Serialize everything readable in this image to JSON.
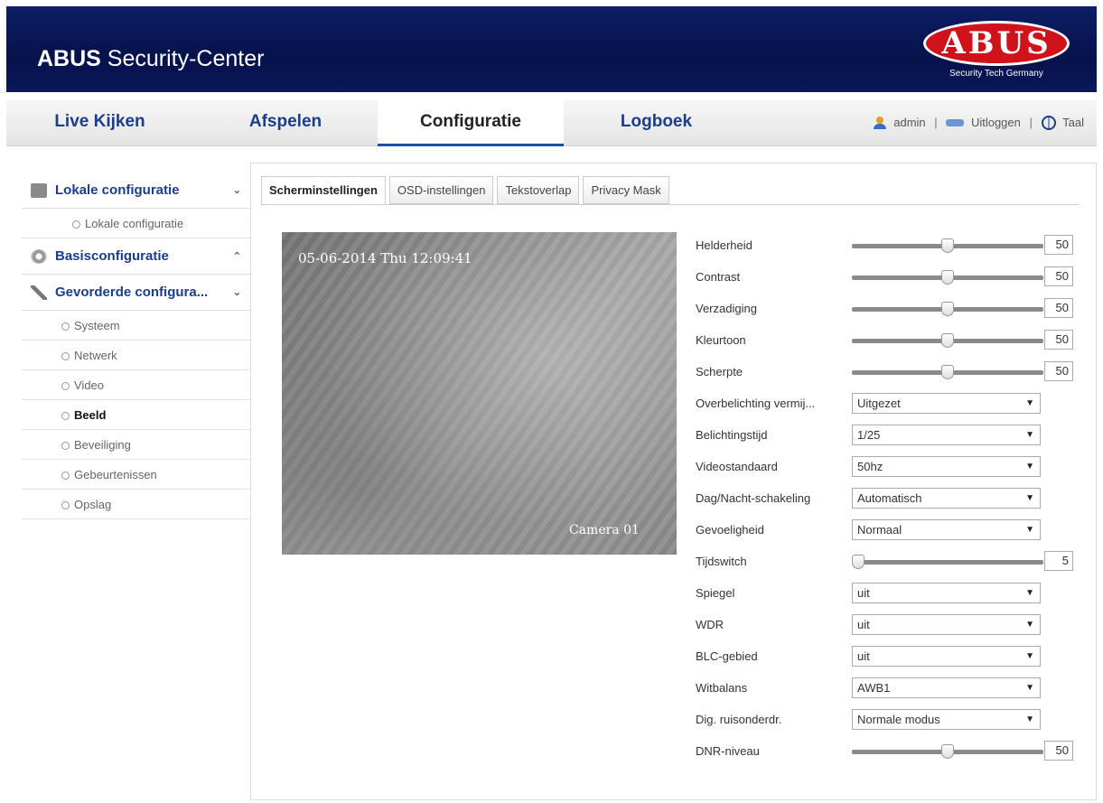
{
  "header": {
    "brand_bold": "ABUS",
    "brand_rest": "Security-Center",
    "logo_text": "ABUS",
    "logo_sub": "Security Tech Germany"
  },
  "nav": {
    "tabs": [
      "Live Kijken",
      "Afspelen",
      "Configuratie",
      "Logboek"
    ],
    "active": "Configuratie",
    "user": "admin",
    "logout": "Uitloggen",
    "language": "Taal"
  },
  "sidebar": {
    "local": {
      "title": "Lokale configuratie",
      "items": [
        "Lokale configuratie"
      ]
    },
    "basic": {
      "title": "Basisconfiguratie"
    },
    "advanced": {
      "title": "Gevorderde configura...",
      "items": [
        "Systeem",
        "Netwerk",
        "Video",
        "Beeld",
        "Beveiliging",
        "Gebeurtenissen",
        "Opslag"
      ],
      "active": "Beeld"
    },
    "icons": {
      "local": "monitor-icon",
      "basic": "gear-icon",
      "advanced": "wrench-icon"
    }
  },
  "tabs": [
    "Scherminstellingen",
    "OSD-instellingen",
    "Tekstoverlap",
    "Privacy Mask"
  ],
  "video": {
    "timestamp": "05-06-2014 Thu 12:09:41",
    "camera": "Camera 01"
  },
  "settings": {
    "brightness": {
      "label": "Helderheid",
      "value": "50",
      "level": 0.5
    },
    "contrast": {
      "label": "Contrast",
      "value": "50",
      "level": 0.5
    },
    "saturation": {
      "label": "Verzadiging",
      "value": "50",
      "level": 0.5
    },
    "hue": {
      "label": "Kleurtoon",
      "value": "50",
      "level": 0.5
    },
    "sharpness": {
      "label": "Scherpte",
      "value": "50",
      "level": 0.5
    },
    "overexposure": {
      "label": "Overbelichting vermij...",
      "value": "Uitgezet"
    },
    "exposure_time": {
      "label": "Belichtingstijd",
      "value": "1/25"
    },
    "video_standard": {
      "label": "Videostandaard",
      "value": "50hz"
    },
    "day_night": {
      "label": "Dag/Nacht-schakeling",
      "value": "Automatisch"
    },
    "sensitivity": {
      "label": "Gevoeligheid",
      "value": "Normaal"
    },
    "time_switch": {
      "label": "Tijdswitch",
      "value": "5",
      "level": 0.0
    },
    "mirror": {
      "label": "Spiegel",
      "value": "uit"
    },
    "wdr": {
      "label": "WDR",
      "value": "uit"
    },
    "blc_area": {
      "label": "BLC-gebied",
      "value": "uit"
    },
    "white_balance": {
      "label": "Witbalans",
      "value": "AWB1"
    },
    "dnr": {
      "label": "Dig. ruisonderdr.",
      "value": "Normale modus"
    },
    "dnr_level": {
      "label": "DNR-niveau",
      "value": "50",
      "level": 0.5
    }
  }
}
